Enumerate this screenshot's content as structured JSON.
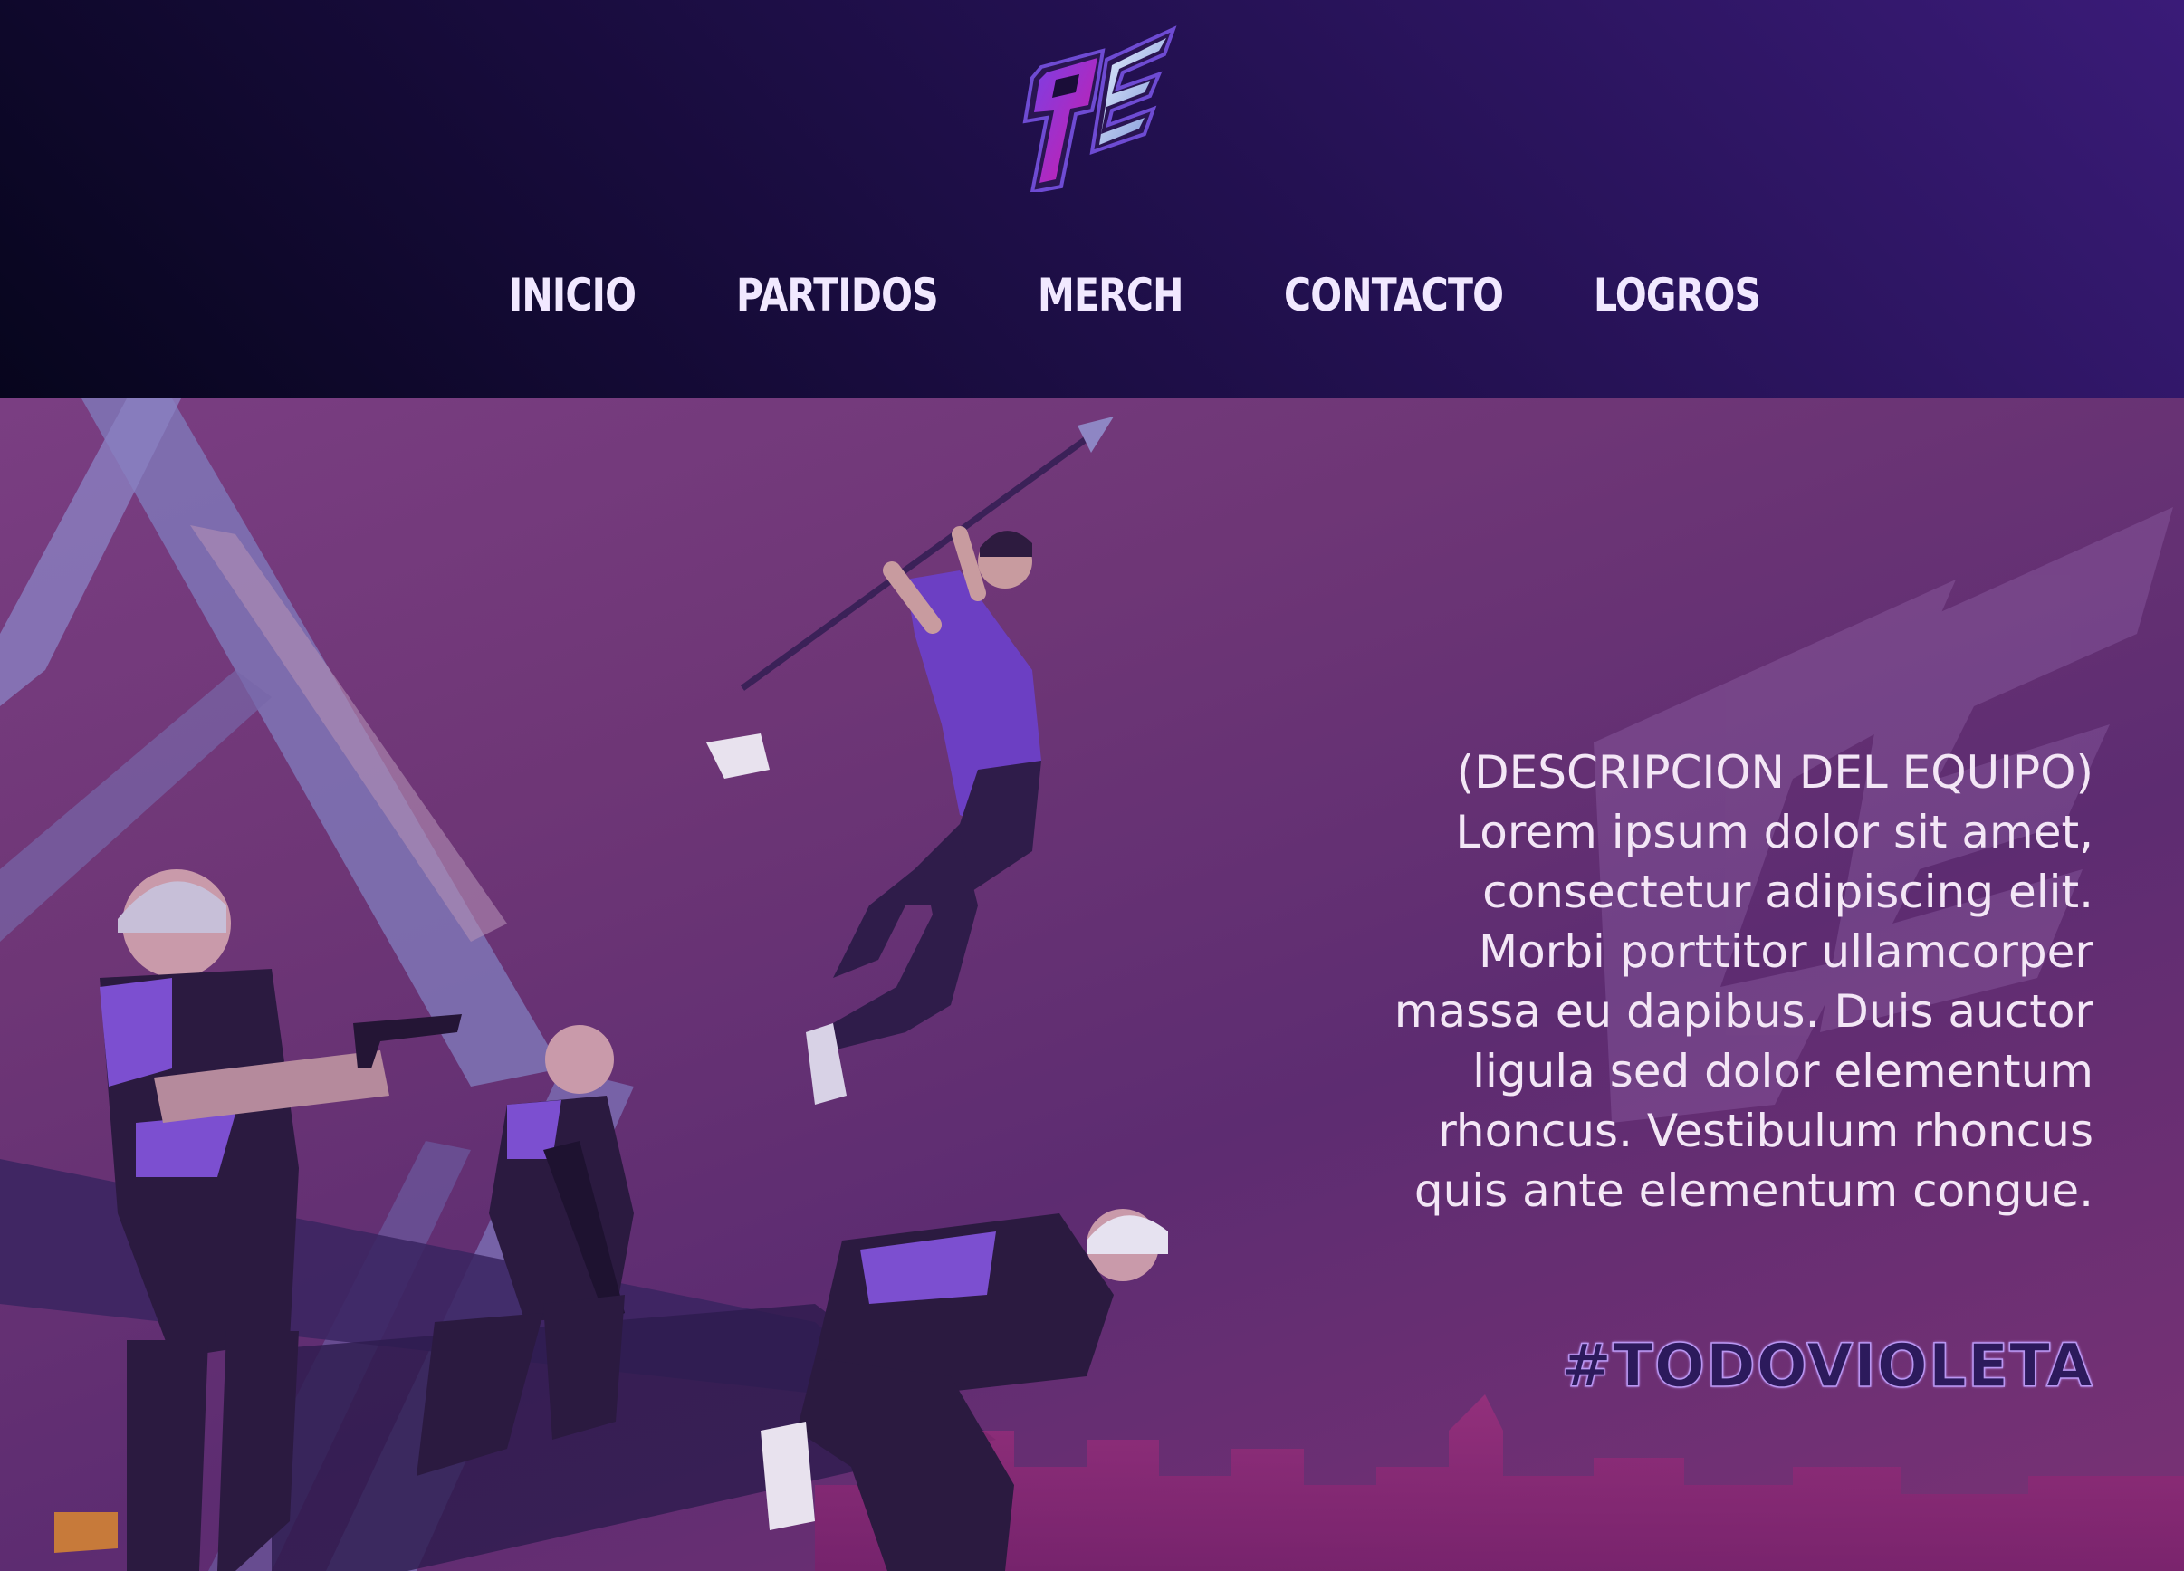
{
  "header": {
    "logo_icon": "team-logo-icon",
    "nav": [
      {
        "label": "INICIO"
      },
      {
        "label": "PARTIDOS"
      },
      {
        "label": "MERCH"
      },
      {
        "label": "CONTACTO"
      },
      {
        "label": "LOGROS"
      }
    ]
  },
  "hero": {
    "description_title": "(DESCRIPCION DEL EQUIPO)",
    "description_lines": [
      "Lorem ipsum dolor sit amet,",
      "consectetur adipiscing elit.",
      "Morbi porttitor ullamcorper",
      "massa eu dapibus. Duis auctor",
      "ligula sed dolor elementum",
      "rhoncus. Vestibulum rhoncus",
      "quis ante elementum congue."
    ],
    "hashtag": "#TODOVIOLETA",
    "illustration_icon": "team-players-illustration"
  },
  "colors": {
    "header_dark": "#07051d",
    "header_purple": "#3a1b78",
    "hero_purple": "#6e3676",
    "nav_text": "#f1e8ff",
    "hashtag_fill": "#2c1a5c"
  }
}
